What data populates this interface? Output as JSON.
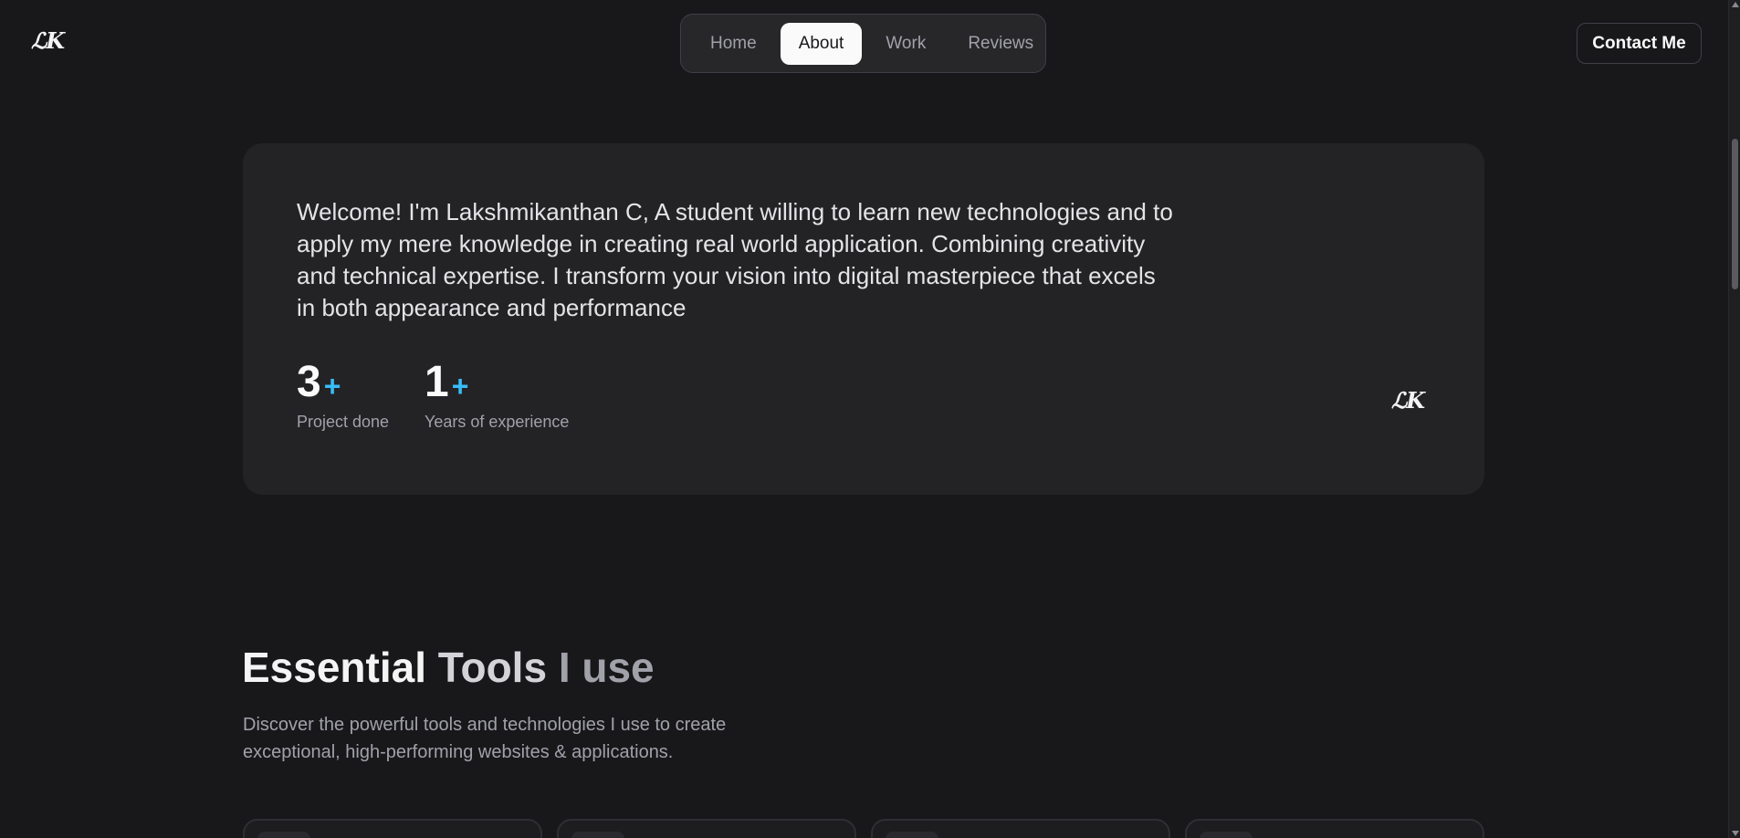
{
  "header": {
    "logo": "ℒK",
    "nav": [
      {
        "label": "Home",
        "active": false
      },
      {
        "label": "About",
        "active": true
      },
      {
        "label": "Work",
        "active": false
      },
      {
        "label": "Reviews",
        "active": false
      }
    ],
    "contact_label": "Contact Me"
  },
  "about": {
    "text": "Welcome! I'm Lakshmikanthan C, A student willing to learn new technologies and to apply my mere knowledge in creating real world application. Combining creativity and technical expertise. I transform your vision into digital masterpiece that excels in both appearance and performance",
    "stats": [
      {
        "value": "3",
        "suffix": "+",
        "label": "Project done"
      },
      {
        "value": "1",
        "suffix": "+",
        "label": "Years of experience"
      }
    ],
    "logo": "ℒK"
  },
  "tools": {
    "title_part1": "Essential",
    "title_part2": "Tools",
    "title_part3": "I use",
    "description": "Discover the powerful tools and technologies I use to create exceptional, high-performing websites & applications."
  },
  "colors": {
    "background": "#18181b",
    "card": "#232326",
    "accent": "#38bdf8"
  }
}
